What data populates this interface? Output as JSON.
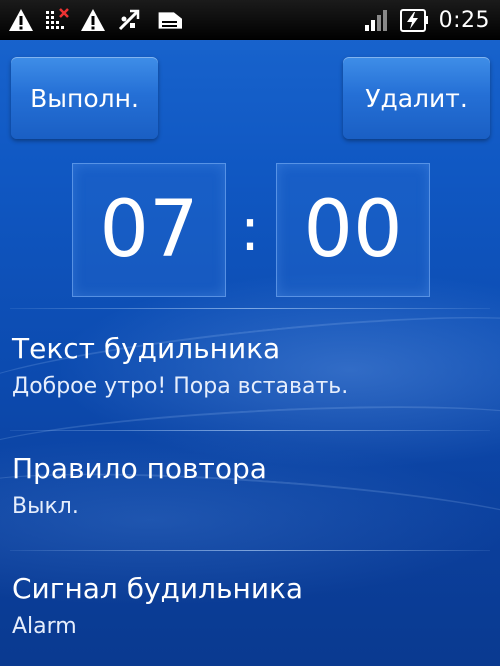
{
  "status_bar": {
    "time": "0:25",
    "left_icons": [
      "warning-icon",
      "network-error-icon",
      "warning-icon",
      "usb-debug-icon",
      "sd-card-icon"
    ],
    "right_icons": [
      "signal-icon",
      "battery-charging-icon"
    ]
  },
  "actions": {
    "done_label": "Выполн.",
    "delete_label": "Удалит."
  },
  "time_picker": {
    "hour": "07",
    "separator": ":",
    "minute": "00"
  },
  "settings": [
    {
      "title": "Текст будильника",
      "value": "Доброе утро! Пора вставать."
    },
    {
      "title": "Правило повтора",
      "value": "Выкл."
    },
    {
      "title": "Сигнал будильника",
      "value": "Alarm"
    }
  ],
  "colors": {
    "background": "#1058c3",
    "button": "#2570d6",
    "text": "#ffffff"
  }
}
